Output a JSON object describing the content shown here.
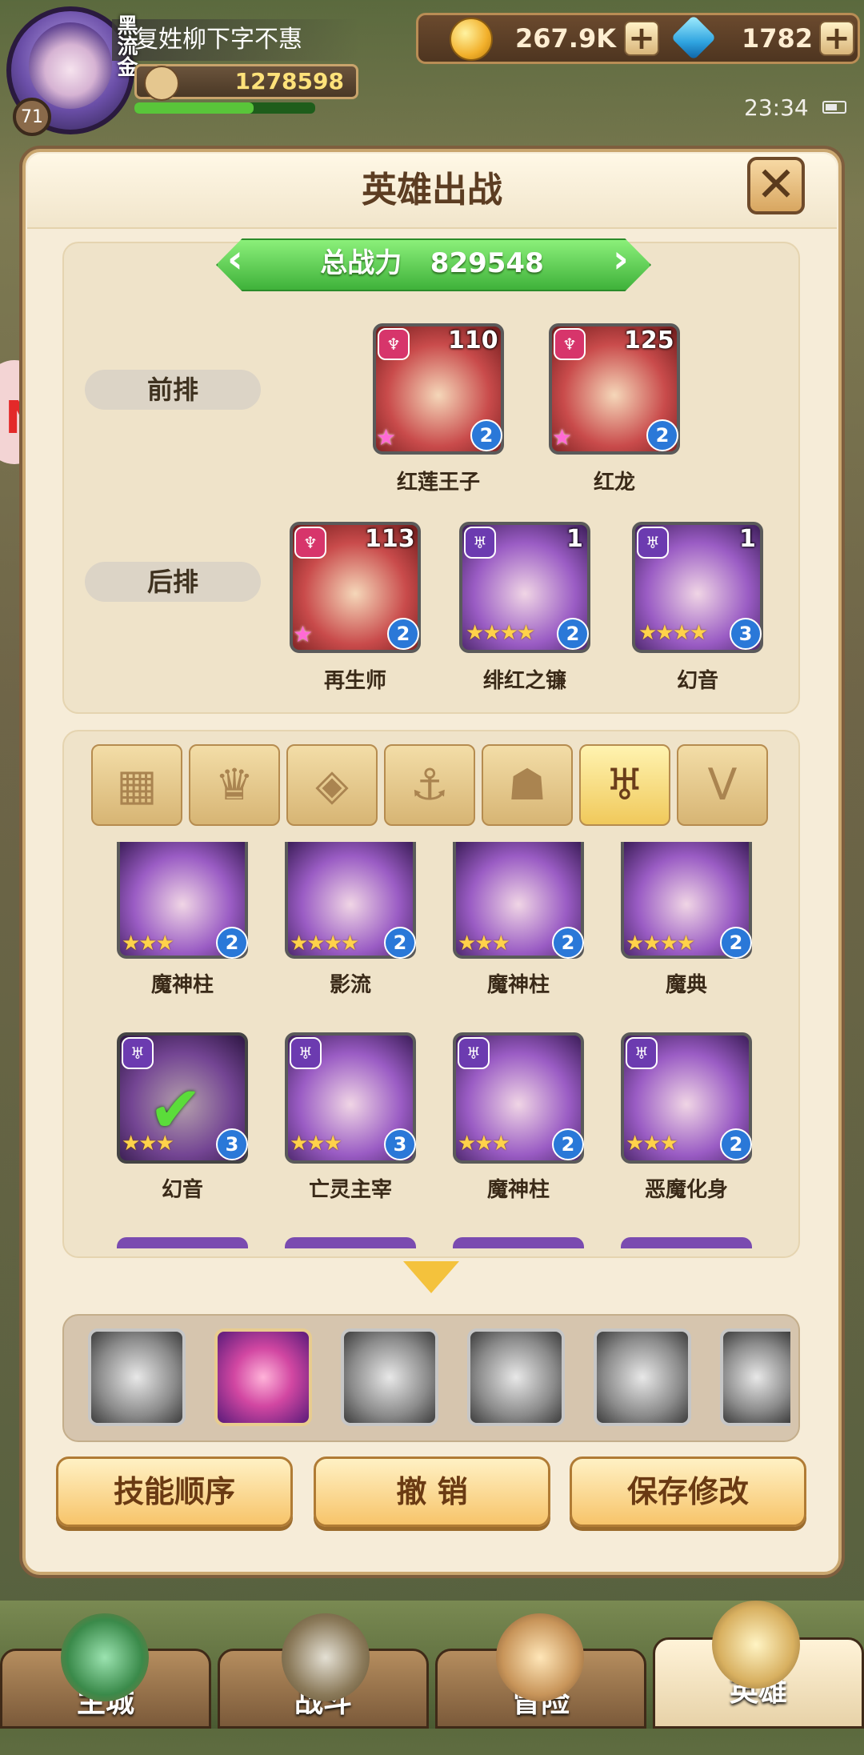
{
  "player": {
    "name": "复姓柳下字不惠",
    "rank_tag": "黑流金",
    "level": "71",
    "power": "1278598",
    "hp_fraction": 0.66
  },
  "resources": {
    "gold": "267.9K",
    "gems": "1782",
    "plus": "+"
  },
  "status": {
    "time": "23:34"
  },
  "panel": {
    "title": "英雄出战",
    "close_symbol": "✕"
  },
  "lineup": {
    "total_label": "总战力",
    "total_value": "829548",
    "front_label": "前排",
    "back_label": "后排",
    "front": [
      {
        "name": "红莲王子",
        "level": "110",
        "rank": "2",
        "faction": "♆",
        "color": "red"
      },
      {
        "name": "红龙",
        "level": "125",
        "rank": "2",
        "faction": "♆",
        "color": "red"
      }
    ],
    "back": [
      {
        "name": "再生师",
        "level": "113",
        "rank": "2",
        "faction": "♆",
        "color": "red"
      },
      {
        "name": "绯红之镰",
        "level": "1",
        "rank": "2",
        "faction": "♅",
        "color": "purple",
        "stars": "★★★★"
      },
      {
        "name": "幻音",
        "level": "1",
        "rank": "3",
        "faction": "♅",
        "color": "purple",
        "stars": "★★★★"
      }
    ]
  },
  "filters": {
    "tabs": [
      {
        "icon": "grid-icon",
        "glyph": "▦"
      },
      {
        "icon": "crown-icon",
        "glyph": "♛"
      },
      {
        "icon": "diamond-icon",
        "glyph": "◈"
      },
      {
        "icon": "anchor-icon",
        "glyph": "⚓"
      },
      {
        "icon": "beast-icon",
        "glyph": "☗"
      },
      {
        "icon": "demon-icon",
        "glyph": "♅"
      },
      {
        "icon": "wing-icon",
        "glyph": "V"
      }
    ]
  },
  "roster": {
    "row1": [
      {
        "name": "魔神柱",
        "rank": "2",
        "stars": "★★★"
      },
      {
        "name": "影流",
        "rank": "2",
        "stars": "★★★★"
      },
      {
        "name": "魔神柱",
        "rank": "2",
        "stars": "★★★"
      },
      {
        "name": "魔典",
        "rank": "2",
        "stars": "★★★★"
      }
    ],
    "row2": [
      {
        "name": "幻音",
        "rank": "3",
        "stars": "★★★"
      },
      {
        "name": "亡灵主宰",
        "rank": "3",
        "stars": "★★★"
      },
      {
        "name": "魔神柱",
        "rank": "2",
        "stars": "★★★"
      },
      {
        "name": "恶魔化身",
        "rank": "2",
        "stars": "★★★"
      }
    ]
  },
  "buttons": {
    "skill_order": "技能顺序",
    "undo": "撤 销",
    "save": "保存修改"
  },
  "nav": {
    "tabs": [
      {
        "label": "主城"
      },
      {
        "label": "战斗"
      },
      {
        "label": "冒险"
      },
      {
        "label": "英雄"
      }
    ]
  },
  "colors": {
    "panel_bg": "#f6ecd8",
    "ribbon_green": "#3fb23a",
    "faction_red": "#d7356b",
    "faction_purple": "#6c3bb0",
    "button_gold": "#f7c46a"
  }
}
